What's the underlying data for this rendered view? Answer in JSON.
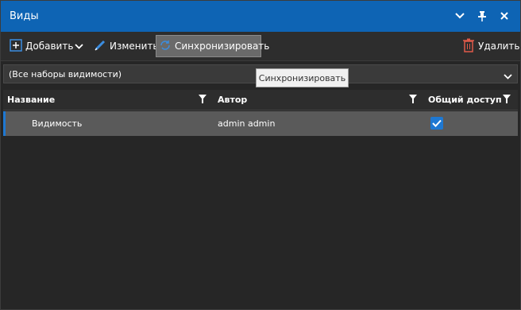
{
  "window": {
    "title": "Виды"
  },
  "toolbar": {
    "add_label": "Добавить",
    "edit_label": "Изменить",
    "sync_label": "Синхронизировать",
    "delete_label": "Удалить"
  },
  "filter_dropdown": {
    "selected": "(Все наборы видимости)"
  },
  "tooltip": {
    "text": "Синхронизировать"
  },
  "table": {
    "columns": [
      "Название",
      "Автор",
      "Общий доступ"
    ],
    "rows": [
      {
        "name": "Видимость",
        "author": "admin admin",
        "shared": true
      }
    ]
  },
  "colors": {
    "accent": "#0e64b4",
    "selection": "#5a5a5a",
    "background": "#262626",
    "delete_icon": "#e05a4a"
  }
}
